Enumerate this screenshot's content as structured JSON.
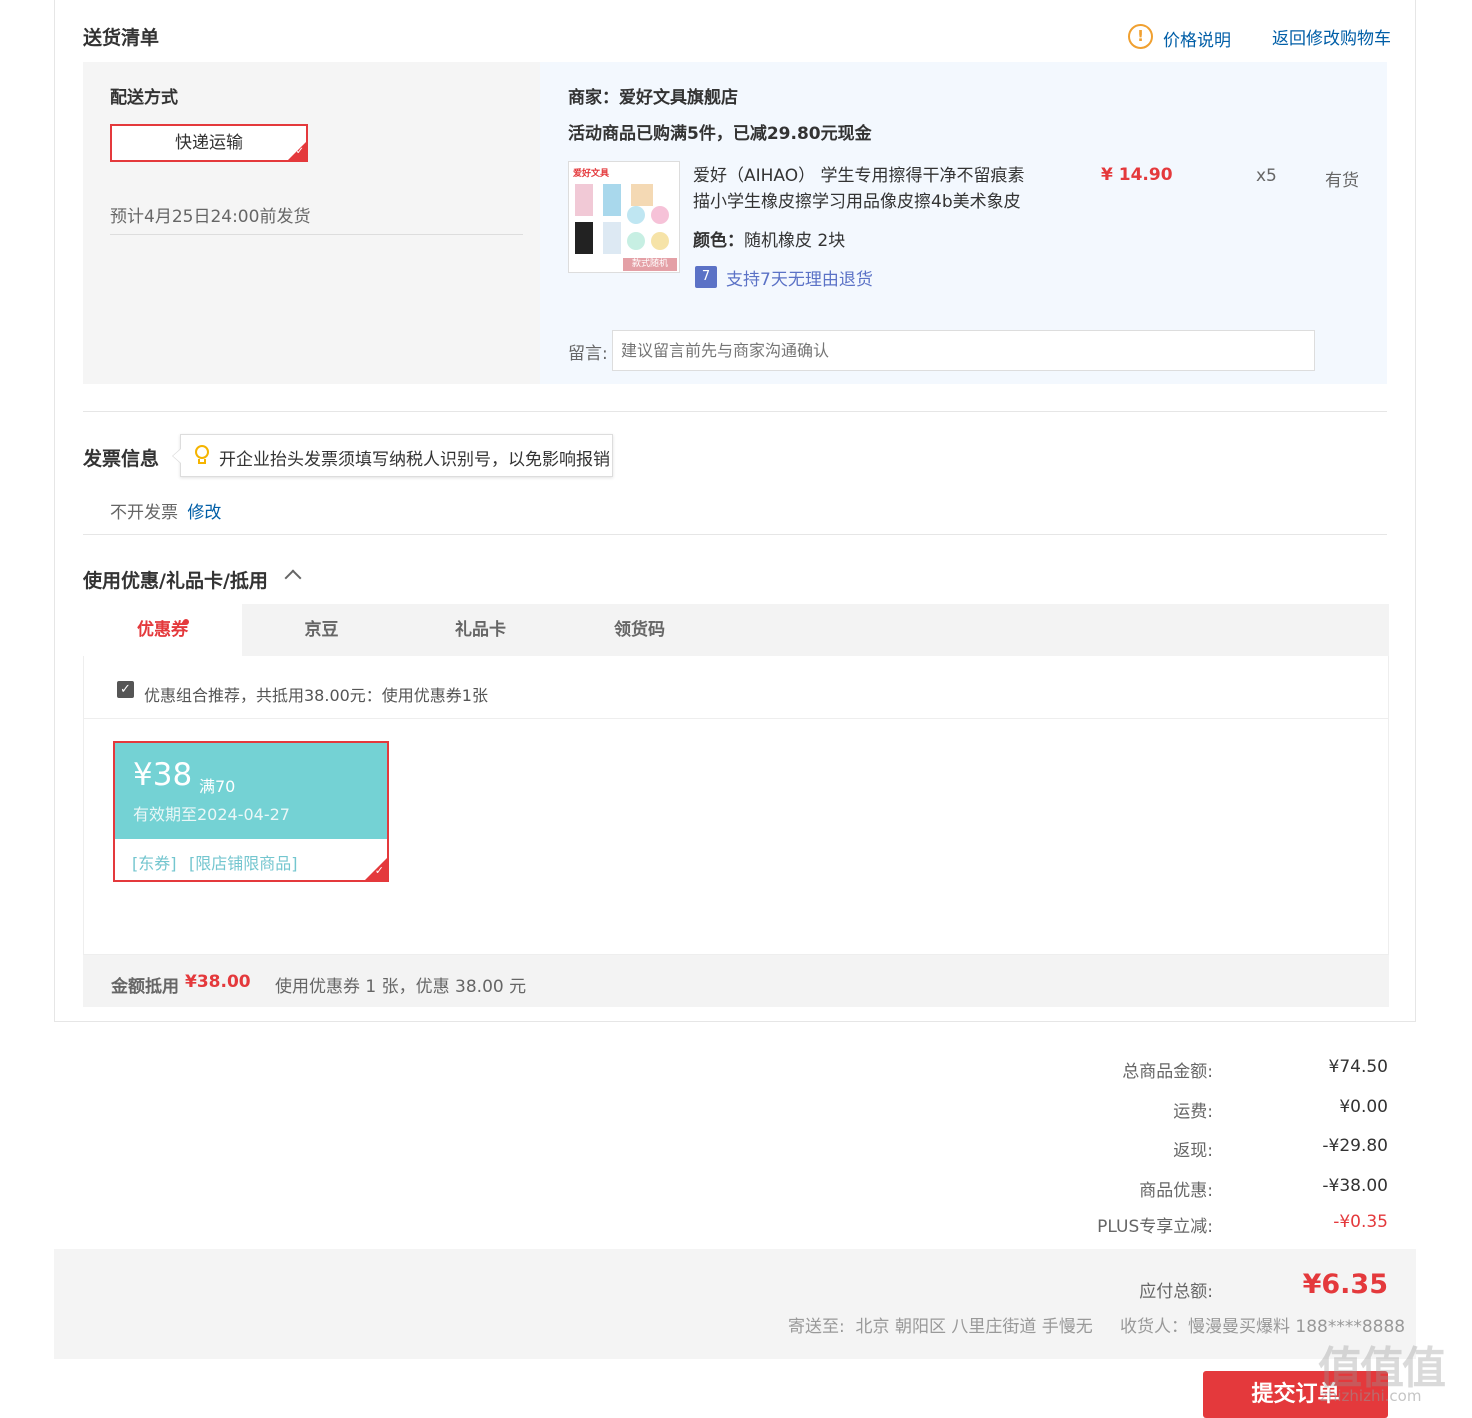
{
  "delivery": {
    "title": "送货清单",
    "price_note": "价格说明",
    "back_cart": "返回修改购物车",
    "method_label": "配送方式",
    "method_value": "快递运输",
    "eta": "预计4月25日24:00前发货",
    "merchant": "商家：爱好文具旗舰店",
    "promo": "活动商品已购满5件，已减29.80元现金",
    "product": {
      "title_line1": "爱好（AIHAO） 学生专用擦得干净不留痕素",
      "title_line2": "描小学生橡皮擦学习用品像皮擦4b美术象皮",
      "color_label": "颜色：",
      "color_value": "随机橡皮 2块",
      "return_policy": "支持7天无理由退货",
      "return_badge": "7",
      "price": "¥ 14.90",
      "qty": "x5",
      "stock": "有货",
      "thumb_brand": "爱好文具",
      "thumb_tag": "款式随机"
    },
    "note_label": "留言:",
    "note_placeholder": "建议留言前先与商家沟通确认"
  },
  "invoice": {
    "title": "发票信息",
    "tip": "开企业抬头发票须填写纳税人识别号，以免影响报销",
    "status": "不开发票",
    "edit": "修改"
  },
  "discount": {
    "title": "使用优惠/礼品卡/抵用",
    "tabs": [
      {
        "label": "优惠券",
        "active": true
      },
      {
        "label": "京豆",
        "active": false
      },
      {
        "label": "礼品卡",
        "active": false
      },
      {
        "label": "领货码",
        "active": false
      }
    ],
    "combo": "优惠组合推荐，共抵用38.00元：使用优惠券1张",
    "coupon": {
      "amount": "¥38",
      "threshold": "满70",
      "expiry": "有效期至2024-04-27",
      "tag1": "[东券]",
      "tag2": "[限店铺限商品]"
    },
    "footer_label": "金额抵用",
    "footer_amount": "¥38.00",
    "footer_desc": "使用优惠券 1 张，优惠 38.00 元"
  },
  "summary": {
    "rows": [
      {
        "label": "总商品金额:",
        "value": "¥74.50"
      },
      {
        "label": "运费:",
        "value": "¥0.00"
      },
      {
        "label": "返现:",
        "value": "-¥29.80"
      },
      {
        "label": "商品优惠:",
        "value": "-¥38.00"
      },
      {
        "label": "PLUS专享立减:",
        "value": "-¥0.35"
      }
    ],
    "total_label": "应付总额:",
    "total_value": "¥6.35",
    "ship_to": "寄送至:  北京 朝阳区 八里庄街道 手慢无",
    "receiver": "收货人：慢漫曼买爆料 188****8888",
    "submit": "提交订单"
  },
  "watermark": {
    "text": "值值值",
    "site": "zhizhizhi.com"
  },
  "colors": {
    "accent": "#e4393c",
    "link": "#005ea7",
    "coupon": "#74d2d4",
    "plus": "#e4393c"
  }
}
